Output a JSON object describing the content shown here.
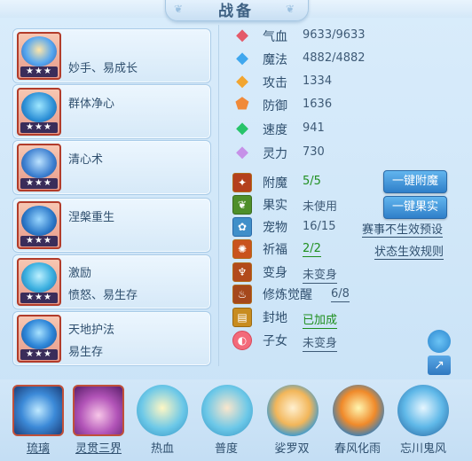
{
  "title": "战备",
  "skills": [
    {
      "name": "妙手、易成长",
      "sub": "",
      "stars": "★★★"
    },
    {
      "name": "群体净心",
      "sub": "",
      "stars": "★★★"
    },
    {
      "name": "清心术",
      "sub": "",
      "stars": "★★★"
    },
    {
      "name": "涅槃重生",
      "sub": "",
      "stars": "★★★"
    },
    {
      "name": "激励",
      "sub": "愤怒、易生存",
      "stars": "★★★"
    },
    {
      "name": "天地护法",
      "sub": "易生存",
      "stars": "★★★"
    }
  ],
  "attributes": [
    {
      "label": "气血",
      "value": "9633/9633",
      "icon": "heart-icon",
      "color": "#e45a6a"
    },
    {
      "label": "魔法",
      "value": "4882/4882",
      "icon": "mana-icon",
      "color": "#3fa7ee"
    },
    {
      "label": "攻击",
      "value": "1334",
      "icon": "attack-icon",
      "color": "#f2a530"
    },
    {
      "label": "防御",
      "value": "1636",
      "icon": "defense-icon",
      "color": "#f08a3a"
    },
    {
      "label": "速度",
      "value": "941",
      "icon": "speed-icon",
      "color": "#27c46a"
    },
    {
      "label": "灵力",
      "value": "730",
      "icon": "spirit-icon",
      "color": "#c691e8"
    }
  ],
  "status": {
    "enchant": {
      "label": "附魔",
      "value": "5/5"
    },
    "fruit": {
      "label": "果实",
      "value": "未使用"
    },
    "pet": {
      "label": "宠物",
      "value": "16/15"
    },
    "blessing": {
      "label": "祈福",
      "value": "2/2"
    },
    "transform": {
      "label": "变身",
      "value": "未变身"
    },
    "awaken": {
      "label": "修炼觉醒",
      "value": "6/8"
    },
    "land": {
      "label": "封地",
      "value": "已加成"
    },
    "child": {
      "label": "子女",
      "value": "未变身"
    }
  },
  "buttons": {
    "one_click_enchant": "一键附魔",
    "one_click_fruit": "一键果实"
  },
  "links": {
    "event_preset": "赛事不生效预设",
    "status_rules": "状态生效规则"
  },
  "formations": [
    {
      "name": "琉璃",
      "selected": true
    },
    {
      "name": "灵贯三界",
      "selected": true
    },
    {
      "name": "热血",
      "selected": false
    },
    {
      "name": "普度",
      "selected": false
    },
    {
      "name": "娑罗双",
      "selected": false
    },
    {
      "name": "春风化雨",
      "selected": false
    },
    {
      "name": "忘川鬼风",
      "selected": false
    }
  ]
}
